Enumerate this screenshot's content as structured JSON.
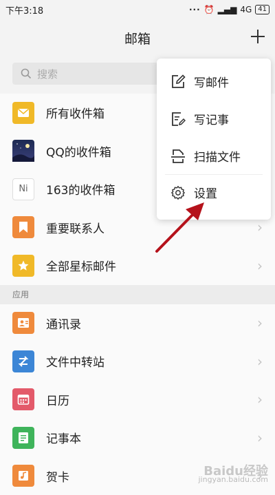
{
  "status_bar": {
    "time": "下午3:18",
    "network": "4G",
    "battery": "41"
  },
  "header": {
    "title": "邮箱"
  },
  "search": {
    "placeholder": "搜索"
  },
  "mailboxes": [
    {
      "label": "所有收件箱",
      "icon": "mail-icon"
    },
    {
      "label": "QQ的收件箱",
      "icon": "qq-avatar-icon"
    },
    {
      "label": "163的收件箱",
      "icon": "ni-icon",
      "icon_text": "Ni"
    },
    {
      "label": "重要联系人",
      "icon": "bookmark-icon"
    },
    {
      "label": "全部星标邮件",
      "icon": "star-icon"
    }
  ],
  "apps_section": {
    "title": "应用"
  },
  "apps": [
    {
      "label": "通讯录",
      "icon": "contacts-icon"
    },
    {
      "label": "文件中转站",
      "icon": "transfer-icon"
    },
    {
      "label": "日历",
      "icon": "calendar-icon"
    },
    {
      "label": "记事本",
      "icon": "notebook-icon"
    },
    {
      "label": "贺卡",
      "icon": "card-icon"
    }
  ],
  "menu": {
    "items": [
      {
        "label": "写邮件",
        "icon": "compose-icon"
      },
      {
        "label": "写记事",
        "icon": "note-icon"
      },
      {
        "label": "扫描文件",
        "icon": "scan-icon"
      },
      {
        "label": "设置",
        "icon": "gear-icon"
      }
    ]
  },
  "watermark": {
    "text1": "Baidu经验",
    "text2": "jingyan.baidu.com"
  }
}
